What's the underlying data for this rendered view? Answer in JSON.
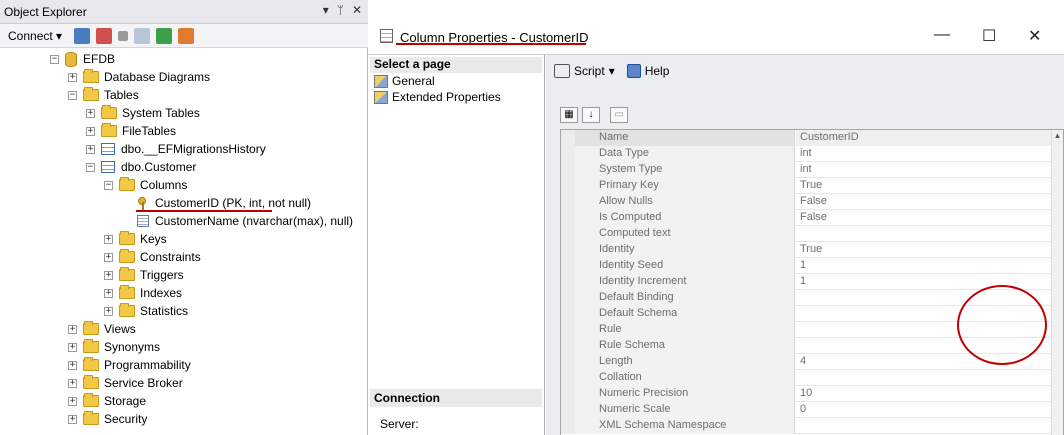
{
  "object_explorer": {
    "title": "Object Explorer",
    "title_controls": [
      "▾",
      "ᛘ",
      "✕"
    ],
    "connect_label": "Connect",
    "tree": [
      {
        "label": "EFDB",
        "icon": "database-icon",
        "exp": "−",
        "indent": 0
      },
      {
        "label": "Database Diagrams",
        "icon": "folder-icon",
        "exp": "+",
        "indent": 1
      },
      {
        "label": "Tables",
        "icon": "folder-icon",
        "exp": "−",
        "indent": 1
      },
      {
        "label": "System Tables",
        "icon": "folder-icon",
        "exp": "+",
        "indent": 2
      },
      {
        "label": "FileTables",
        "icon": "folder-icon",
        "exp": "+",
        "indent": 2
      },
      {
        "label": "dbo.__EFMigrationsHistory",
        "icon": "table-icon",
        "exp": "+",
        "indent": 2
      },
      {
        "label": "dbo.Customer",
        "icon": "table-icon",
        "exp": "−",
        "indent": 2
      },
      {
        "label": "Columns",
        "icon": "folder-icon",
        "exp": "−",
        "indent": 3
      },
      {
        "label": "CustomerID (PK, int, not null)",
        "icon": "primary-key-icon",
        "exp": "",
        "indent": 4
      },
      {
        "label": "CustomerName (nvarchar(max), null)",
        "icon": "column-icon",
        "exp": "",
        "indent": 4
      },
      {
        "label": "Keys",
        "icon": "folder-icon",
        "exp": "+",
        "indent": 3
      },
      {
        "label": "Constraints",
        "icon": "folder-icon",
        "exp": "+",
        "indent": 3
      },
      {
        "label": "Triggers",
        "icon": "folder-icon",
        "exp": "+",
        "indent": 3
      },
      {
        "label": "Indexes",
        "icon": "folder-icon",
        "exp": "+",
        "indent": 3
      },
      {
        "label": "Statistics",
        "icon": "folder-icon",
        "exp": "+",
        "indent": 3
      },
      {
        "label": "Views",
        "icon": "folder-icon",
        "exp": "+",
        "indent": 1
      },
      {
        "label": "Synonyms",
        "icon": "folder-icon",
        "exp": "+",
        "indent": 1
      },
      {
        "label": "Programmability",
        "icon": "folder-icon",
        "exp": "+",
        "indent": 1
      },
      {
        "label": "Service Broker",
        "icon": "folder-icon",
        "exp": "+",
        "indent": 1
      },
      {
        "label": "Storage",
        "icon": "folder-icon",
        "exp": "+",
        "indent": 1
      },
      {
        "label": "Security",
        "icon": "folder-icon",
        "exp": "+",
        "indent": 1
      }
    ]
  },
  "column_properties": {
    "title": "Column Properties - CustomerID",
    "select_page_label": "Select a page",
    "pages": [
      {
        "label": "General"
      },
      {
        "label": "Extended Properties"
      }
    ],
    "connection_label": "Connection",
    "server_label": "Server:",
    "toolbar": {
      "script_label": "Script",
      "help_label": "Help"
    },
    "properties": [
      {
        "name": "Name",
        "value": "CustomerID"
      },
      {
        "name": "Data Type",
        "value": "int"
      },
      {
        "name": "System Type",
        "value": "int"
      },
      {
        "name": "Primary Key",
        "value": "True"
      },
      {
        "name": "Allow Nulls",
        "value": "False"
      },
      {
        "name": "Is Computed",
        "value": "False"
      },
      {
        "name": "Computed text",
        "value": ""
      },
      {
        "name": "Identity",
        "value": "True"
      },
      {
        "name": "Identity Seed",
        "value": "1"
      },
      {
        "name": "Identity Increment",
        "value": "1"
      },
      {
        "name": "Default Binding",
        "value": ""
      },
      {
        "name": "Default Schema",
        "value": ""
      },
      {
        "name": "Rule",
        "value": ""
      },
      {
        "name": "Rule Schema",
        "value": ""
      },
      {
        "name": "Length",
        "value": "4"
      },
      {
        "name": "Collation",
        "value": ""
      },
      {
        "name": "Numeric Precision",
        "value": "10"
      },
      {
        "name": "Numeric Scale",
        "value": "0"
      },
      {
        "name": "XML Schema Namespace",
        "value": ""
      }
    ]
  },
  "colors": {
    "annotation_red": "#c00000",
    "folder_yellow": "#f3c846"
  }
}
